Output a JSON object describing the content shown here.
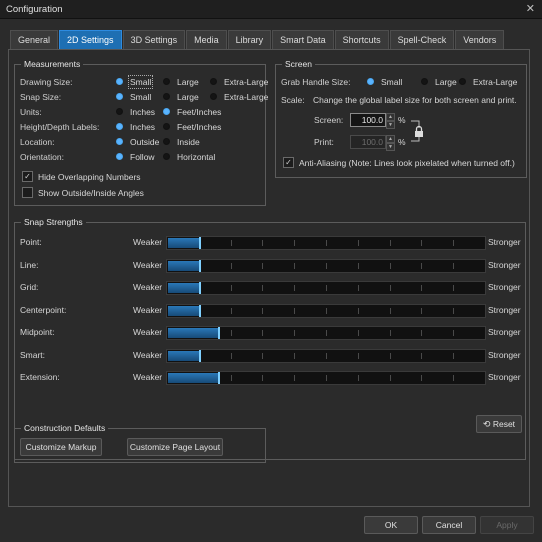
{
  "window": {
    "title": "Configuration",
    "close_glyph": "✕"
  },
  "tabs": [
    {
      "label": "General",
      "active": false
    },
    {
      "label": "2D Settings",
      "active": true
    },
    {
      "label": "3D Settings",
      "active": false
    },
    {
      "label": "Media",
      "active": false
    },
    {
      "label": "Library",
      "active": false
    },
    {
      "label": "Smart Data",
      "active": false
    },
    {
      "label": "Shortcuts",
      "active": false
    },
    {
      "label": "Spell-Check",
      "active": false
    },
    {
      "label": "Vendors",
      "active": false
    }
  ],
  "measurements": {
    "title": "Measurements",
    "rows": [
      {
        "label": "Drawing Size:",
        "options": [
          "Small",
          "Large",
          "Extra-Large"
        ],
        "selected": 0
      },
      {
        "label": "Snap Size:",
        "options": [
          "Small",
          "Large",
          "Extra-Large"
        ],
        "selected": 0
      },
      {
        "label": "Units:",
        "options": [
          "Inches",
          "Feet/Inches"
        ],
        "selected": 1
      },
      {
        "label": "Height/Depth Labels:",
        "options": [
          "Inches",
          "Feet/Inches"
        ],
        "selected": 0
      },
      {
        "label": "Location:",
        "options": [
          "Outside",
          "Inside"
        ],
        "selected": 0
      },
      {
        "label": "Orientation:",
        "options": [
          "Follow",
          "Horizontal"
        ],
        "selected": 0
      }
    ],
    "hide_overlapping": {
      "label": "Hide Overlapping Numbers",
      "checked": true
    },
    "show_angles": {
      "label": "Show Outside/Inside Angles",
      "checked": false
    }
  },
  "screen": {
    "title": "Screen",
    "grab_label": "Grab Handle Size:",
    "grab_options": [
      "Small",
      "Large",
      "Extra-Large"
    ],
    "grab_selected": 0,
    "scale_label": "Scale:",
    "scale_desc": "Change the global label size for both screen and print.",
    "screen_label": "Screen:",
    "screen_value": "100.0",
    "print_label": "Print:",
    "print_value": "100.0",
    "percent": "%",
    "anti_aliasing": {
      "label": "Anti-Aliasing (Note: Lines look pixelated when turned off.)",
      "checked": true
    }
  },
  "snap": {
    "title": "Snap Strengths",
    "weaker": "Weaker",
    "stronger": "Stronger",
    "items": [
      {
        "label": "Point:",
        "level": 0.1
      },
      {
        "label": "Line:",
        "level": 0.1
      },
      {
        "label": "Grid:",
        "level": 0.1
      },
      {
        "label": "Centerpoint:",
        "level": 0.1
      },
      {
        "label": "Midpoint:",
        "level": 0.16
      },
      {
        "label": "Smart:",
        "level": 0.1
      },
      {
        "label": "Extension:",
        "level": 0.16
      }
    ],
    "reset_label": "Reset"
  },
  "construction": {
    "title": "Construction Defaults",
    "markup_label": "Customize Markup",
    "page_layout_label": "Customize Page Layout"
  },
  "footer": {
    "ok": "OK",
    "cancel": "Cancel",
    "apply": "Apply"
  }
}
